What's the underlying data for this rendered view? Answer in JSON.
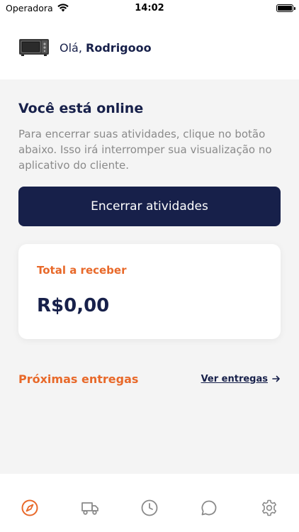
{
  "status_bar": {
    "carrier": "Operadora",
    "time": "14:02",
    "battery_level": 1.0
  },
  "header": {
    "greeting_prefix": "Olá,",
    "user_name": "Rodrigooo",
    "device_icon": "oven-icon"
  },
  "main": {
    "online_title": "Você está online",
    "online_description": "Para encerrar suas atividades, clique no botão abaixo. Isso irá interromper sua visualização no aplicativo do cliente.",
    "end_button_label": "Encerrar atividades",
    "balance": {
      "label": "Total a receber",
      "value": "R$0,00"
    },
    "deliveries": {
      "title": "Próximas entregas",
      "link_label": "Ver entregas",
      "link_icon": "arrow-right-icon"
    }
  },
  "tab_bar": {
    "items": [
      {
        "icon": "compass-icon",
        "active": true
      },
      {
        "icon": "truck-icon",
        "active": false
      },
      {
        "icon": "clock-icon",
        "active": false
      },
      {
        "icon": "chat-bubble-icon",
        "active": false
      },
      {
        "icon": "gear-icon",
        "active": false
      }
    ]
  },
  "colors": {
    "primary": "#17204a",
    "accent": "#e8692a",
    "background": "#f4f4f4",
    "muted_text": "#8a8a8a",
    "inactive_icon": "#8a8a8a"
  }
}
